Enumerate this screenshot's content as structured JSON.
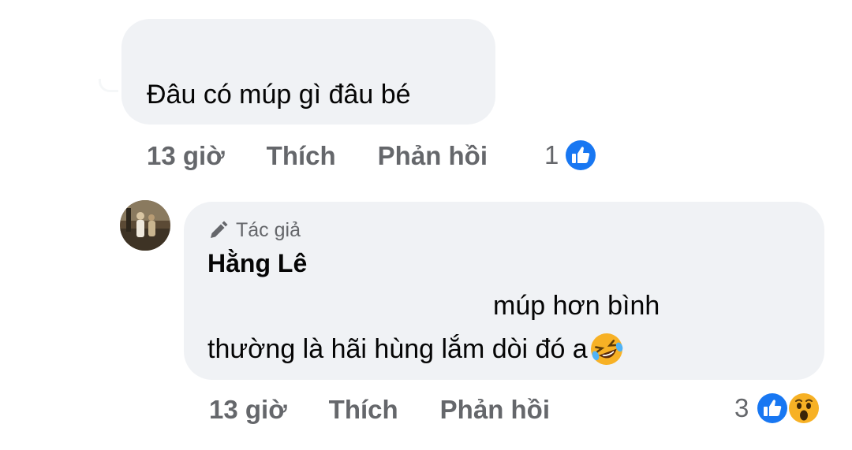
{
  "comment1": {
    "text": "Đâu có múp gì đâu bé",
    "time": "13 giờ",
    "like_label": "Thích",
    "reply_label": "Phản hồi",
    "reaction_count": "1",
    "reactions": [
      "like-icon"
    ]
  },
  "comment2": {
    "badge_label": "Tác giả",
    "author": "Hằng Lê",
    "text_line1": "múp hơn bình",
    "text_line2": "thường là hãi hùng lắm dòi đó a",
    "inline_emoji": "rolling-laughing-emoji",
    "time": "13 giờ",
    "like_label": "Thích",
    "reply_label": "Phản hồi",
    "reaction_count": "3",
    "reactions": [
      "like-icon",
      "wow-icon"
    ]
  },
  "colors": {
    "bubble": "#f0f2f5",
    "secondary_text": "#65676b",
    "like_blue": "#1877f2",
    "emoji_yellow": "#f7b125"
  }
}
